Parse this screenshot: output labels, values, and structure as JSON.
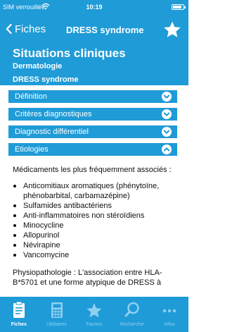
{
  "status_bar": {
    "carrier": "SIM verrouillée",
    "time": "10:19"
  },
  "nav": {
    "back_label": "Fiches",
    "title": "DRESS syndrome",
    "favorite_icon": "star-icon"
  },
  "header": {
    "title": "Situations cliniques",
    "specialty": "Dermatologie",
    "topic": "DRESS syndrome"
  },
  "accordion": [
    {
      "label": "Définition",
      "state": "collapsed"
    },
    {
      "label": "Critères diagnostiques",
      "state": "collapsed"
    },
    {
      "label": "Diagnostic différentiel",
      "state": "collapsed"
    },
    {
      "label": "Etiologies",
      "state": "expanded"
    }
  ],
  "content": {
    "intro": "Médicaments les plus fréquemment associés :",
    "drugs": [
      "Anticomitiaux aromatiques (phénytoïne, phénobarbital, carbamazépine)",
      "Sulfamides antibactériens",
      "Anti-inflammatoires non stéroïdiens",
      "Minocycline",
      "Allopurinol",
      "Névirapine",
      "Vancomycine"
    ],
    "physiopathology": "Physiopathologie : L'association entre HLA-B*5701 et une forme atypique de DRESS à"
  },
  "tabs": [
    {
      "label": "Fiches",
      "icon": "document-icon",
      "active": true
    },
    {
      "label": "Utilitaires",
      "icon": "calculator-icon",
      "active": false
    },
    {
      "label": "Favoris",
      "icon": "star-icon",
      "active": false
    },
    {
      "label": "Recherche",
      "icon": "search-icon",
      "active": false
    },
    {
      "label": "Infos",
      "icon": "more-icon",
      "active": false
    }
  ],
  "colors": {
    "primary": "#1f9bd7",
    "tab_inactive": "#8fd0f0",
    "text": "#111111",
    "background": "#ffffff"
  }
}
